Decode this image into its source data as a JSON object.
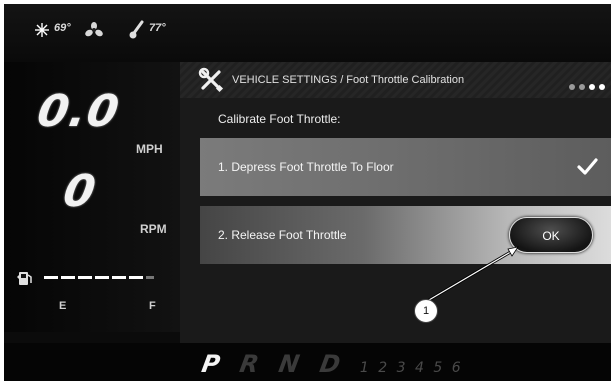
{
  "climate": {
    "snow_icon": "snowflake-icon",
    "temp_in": "69°",
    "fan_icon": "fan-icon",
    "thermometer_icon": "thermometer-icon",
    "temp_out": "77°"
  },
  "gauges": {
    "speed": "0.0",
    "speed_unit": "MPH",
    "rpm": "0",
    "rpm_unit": "RPM",
    "fuel_icon": "fuel-pump-icon",
    "fuel_empty": "E",
    "fuel_full": "F"
  },
  "settings": {
    "icon": "wrench-screwdriver-icon",
    "title": "VEHICLE SETTINGS / Foot Throttle Calibration",
    "calibrate_label": "Calibrate Foot Throttle:",
    "step1_label": "1. Depress Foot Throttle To Floor",
    "step1_icon": "checkmark-icon",
    "step2_label": "2. Release Foot Throttle",
    "ok_label": "OK"
  },
  "gears": {
    "main": [
      "P",
      "R",
      "N",
      "D"
    ],
    "numbers": [
      "1",
      "2",
      "3",
      "4",
      "5",
      "6"
    ]
  },
  "callout": {
    "label": "1"
  }
}
